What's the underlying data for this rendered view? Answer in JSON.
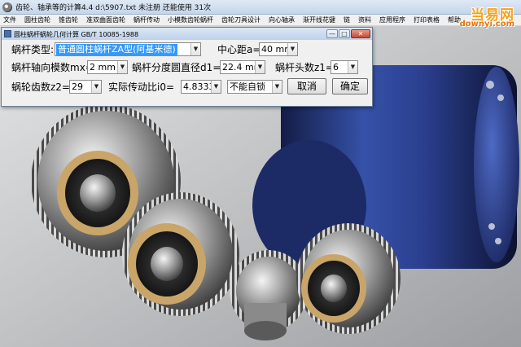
{
  "app": {
    "title": "齿轮、轴承等的计算4.4   d:\\5907.txt 未注册 还能使用 31次"
  },
  "menu": [
    "文件",
    "圆柱齿轮",
    "锥齿轮",
    "准双曲面齿轮",
    "蜗杆传动",
    "小模数齿轮蜗杆",
    "齿轮刀具设计",
    "向心轴承",
    "渐开线花键",
    "链",
    "资料",
    "应用程序",
    "打印表格",
    "帮助"
  ],
  "dialog": {
    "title": "圆柱蜗杆蜗轮几何计算   GB/T 10085-1988",
    "worm_type": {
      "label": "蜗杆类型:",
      "value": "普通圆柱蜗杆ZA型(阿基米德)"
    },
    "center_distance": {
      "label": "中心距a=",
      "value": "40 mm"
    },
    "axial_module": {
      "label": "蜗杆轴向模数mx=",
      "value": "2 mm"
    },
    "pitch_diameter": {
      "label": "蜗杆分度圆直径d1=",
      "value": "22.4 mm"
    },
    "worm_starts": {
      "label": "蜗杆头数z1=",
      "value": "6"
    },
    "wheel_teeth": {
      "label": "蜗轮齿数z2=",
      "value": "29"
    },
    "ratio": {
      "label": "实际传动比i0=",
      "value": "4.8333"
    },
    "self_lock": {
      "value": "不能自锁"
    },
    "cancel_label": "取消",
    "ok_label": "确定"
  },
  "watermark": {
    "title": "当易网",
    "sub": "downyi.com"
  },
  "colors": {
    "motor_blue": "#2b3f8f",
    "selection": "#3399ff",
    "title_gradient": "#c4d5ea",
    "watermark_orange": "#f7a21b"
  }
}
